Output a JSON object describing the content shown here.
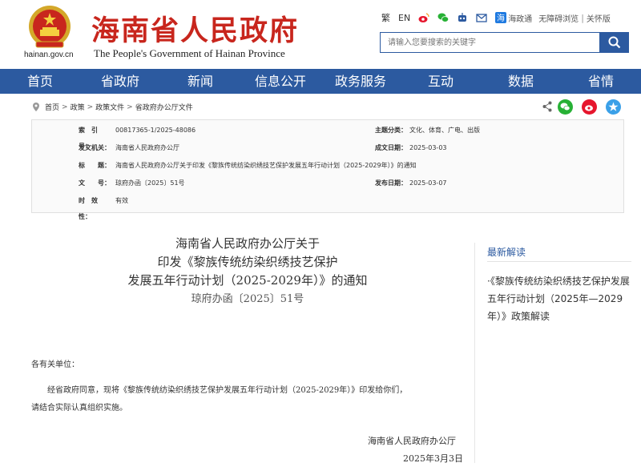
{
  "header": {
    "site_domain": "hainan.gov.cn",
    "cn_title": "海南省人民政府",
    "en_title": "The People's Government  of Hainan Province",
    "links": {
      "traditional": "繁",
      "english": "EN",
      "haiyitong": "海政通",
      "accessible": "无障碍浏览",
      "elderly": "关怀版"
    },
    "search_placeholder": "请输入您要搜索的关键字"
  },
  "nav": [
    "首页",
    "省政府",
    "新闻",
    "信息公开",
    "政务服务",
    "互动",
    "数据",
    "省情"
  ],
  "breadcrumb": [
    "首页",
    "政策",
    "政策文件",
    "省政府办公厅文件"
  ],
  "meta": {
    "index_label": "索　引　号：",
    "index_value": "00817365-1/2025-48086",
    "topic_label": "主题分类：",
    "topic_value": "文化、体育、广电、出版",
    "issuer_label": "发文机关：",
    "issuer_value": "海南省人民政府办公厅",
    "date_label": "成文日期：",
    "date_value": "2025-03-03",
    "title_label": "标　　题：",
    "title_value": "海南省人民政府办公厅关于印发《黎族传统纺染织绣技艺保护发展五年行动计划（2025-2029年）》的通知",
    "docno_label": "文　　号：",
    "docno_value": "琼府办函〔2025〕51号",
    "pub_label": "发布日期：",
    "pub_value": "2025-03-07",
    "valid_label": "时　效　性：",
    "valid_value": "有效"
  },
  "article": {
    "title_line1": "海南省人民政府办公厅关于",
    "title_line2": "印发《黎族传统纺染织绣技艺保护",
    "title_line3": "发展五年行动计划（2025-2029年）》的通知",
    "doc_number": "琼府办函〔2025〕51号",
    "salutation": "各有关单位：",
    "para1_line1": "经省政府同意，现将《黎族传统纺染织绣技艺保护发展五年行动计划（2025-2029年）》印发给你们，",
    "para1_line2": "请结合实际认真组织实施。",
    "signature": "海南省人民政府办公厅",
    "date": "2025年3月3日"
  },
  "sidebar": {
    "heading": "最新解读",
    "item": "·《黎族传统纺染织绣技艺保护发展五年行动计划（2025年—2029年）》政策解读"
  },
  "colors": {
    "brand_red": "#c8261d",
    "nav_blue": "#2c5aa0",
    "wechat_green": "#27b135",
    "weibo_red": "#e6162d"
  }
}
